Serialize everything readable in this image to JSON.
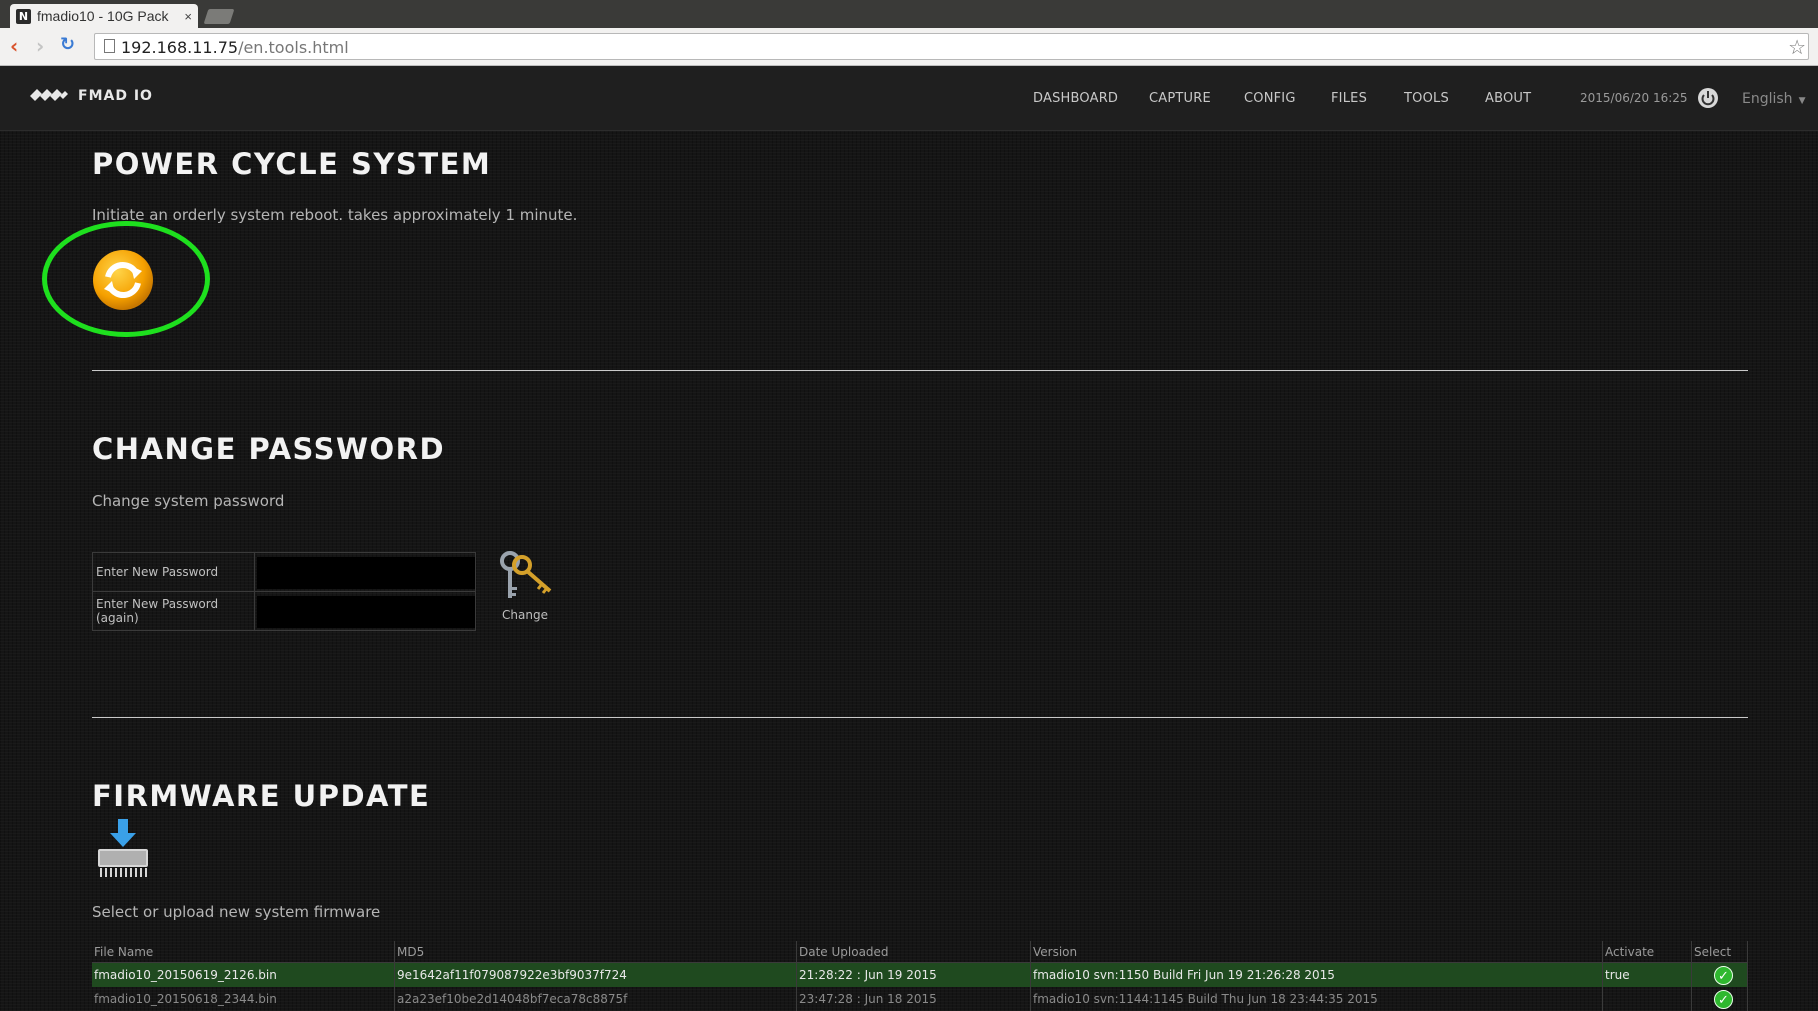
{
  "browser": {
    "tab_title": "fmadio10 - 10G Pack",
    "tab_favicon": "N",
    "tab_close": "×",
    "url_host": "192.168.11.75",
    "url_path": "/en.tools.html"
  },
  "navbar": {
    "brand": "FMAD IO",
    "items": [
      "DASHBOARD",
      "CAPTURE",
      "CONFIG",
      "FILES",
      "TOOLS",
      "ABOUT"
    ],
    "datetime": "2015/06/20 16:25",
    "language": "English"
  },
  "power": {
    "title": "POWER CYCLE SYSTEM",
    "description": "Initiate an orderly system reboot. takes approximately 1 minute.",
    "highlight_color": "#1ee01e"
  },
  "password": {
    "title": "CHANGE PASSWORD",
    "description": "Change system password",
    "new_label": "Enter New Password",
    "again_label": "Enter New Password (again)",
    "change_label": "Change"
  },
  "firmware": {
    "title": "FIRMWARE UPDATE",
    "description": "Select or upload new system firmware",
    "columns": [
      "File Name",
      "MD5",
      "Date Uploaded",
      "Version",
      "Activate",
      "Select"
    ],
    "rows": [
      {
        "file": "fmadio10_20150619_2126.bin",
        "md5": "9e1642af11f079087922e3bf9037f724",
        "date": "21:28:22 : Jun 19 2015",
        "version": "fmadio10 svn:1150 Build Fri Jun 19 21:26:28 2015",
        "activate": "true",
        "active": true
      },
      {
        "file": "fmadio10_20150618_2344.bin",
        "md5": "a2a23ef10be2d14048bf7eca78c8875f",
        "date": "23:47:28 : Jun 18 2015",
        "version": "fmadio10 svn:1144:1145 Build Thu Jun 18 23:44:35 2015",
        "activate": "",
        "active": false
      }
    ]
  },
  "colors": {
    "accent_green": "#1f4a1f",
    "reboot_orange": "#f5a000"
  }
}
